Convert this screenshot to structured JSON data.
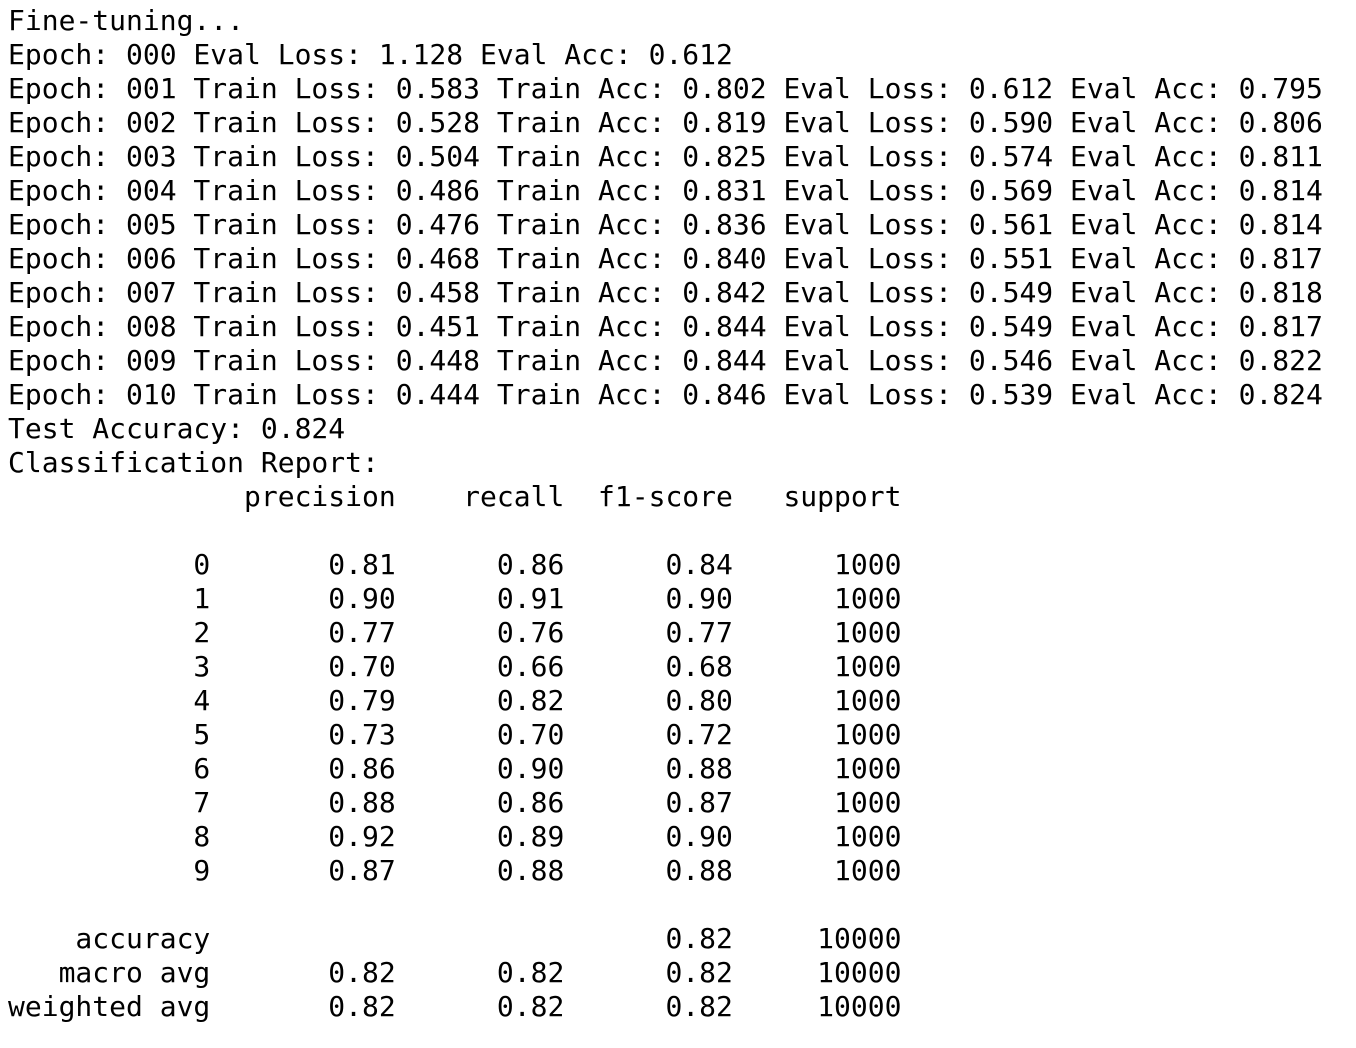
{
  "output": {
    "lines": [
      "Fine-tuning...",
      "Epoch: 000 Eval Loss: 1.128 Eval Acc: 0.612",
      "Epoch: 001 Train Loss: 0.583 Train Acc: 0.802 Eval Loss: 0.612 Eval Acc: 0.795",
      "Epoch: 002 Train Loss: 0.528 Train Acc: 0.819 Eval Loss: 0.590 Eval Acc: 0.806",
      "Epoch: 003 Train Loss: 0.504 Train Acc: 0.825 Eval Loss: 0.574 Eval Acc: 0.811",
      "Epoch: 004 Train Loss: 0.486 Train Acc: 0.831 Eval Loss: 0.569 Eval Acc: 0.814",
      "Epoch: 005 Train Loss: 0.476 Train Acc: 0.836 Eval Loss: 0.561 Eval Acc: 0.814",
      "Epoch: 006 Train Loss: 0.468 Train Acc: 0.840 Eval Loss: 0.551 Eval Acc: 0.817",
      "Epoch: 007 Train Loss: 0.458 Train Acc: 0.842 Eval Loss: 0.549 Eval Acc: 0.818",
      "Epoch: 008 Train Loss: 0.451 Train Acc: 0.844 Eval Loss: 0.549 Eval Acc: 0.817",
      "Epoch: 009 Train Loss: 0.448 Train Acc: 0.844 Eval Loss: 0.546 Eval Acc: 0.822",
      "Epoch: 010 Train Loss: 0.444 Train Acc: 0.846 Eval Loss: 0.539 Eval Acc: 0.824",
      "Test Accuracy: 0.824",
      "Classification Report:",
      "              precision    recall  f1-score   support",
      "",
      "           0       0.81      0.86      0.84      1000",
      "           1       0.90      0.91      0.90      1000",
      "           2       0.77      0.76      0.77      1000",
      "           3       0.70      0.66      0.68      1000",
      "           4       0.79      0.82      0.80      1000",
      "           5       0.73      0.70      0.72      1000",
      "           6       0.86      0.90      0.88      1000",
      "           7       0.88      0.86      0.87      1000",
      "           8       0.92      0.89      0.90      1000",
      "           9       0.87      0.88      0.88      1000",
      "",
      "    accuracy                           0.82     10000",
      "   macro avg       0.82      0.82      0.82     10000",
      "weighted avg       0.82      0.82      0.82     10000"
    ]
  }
}
